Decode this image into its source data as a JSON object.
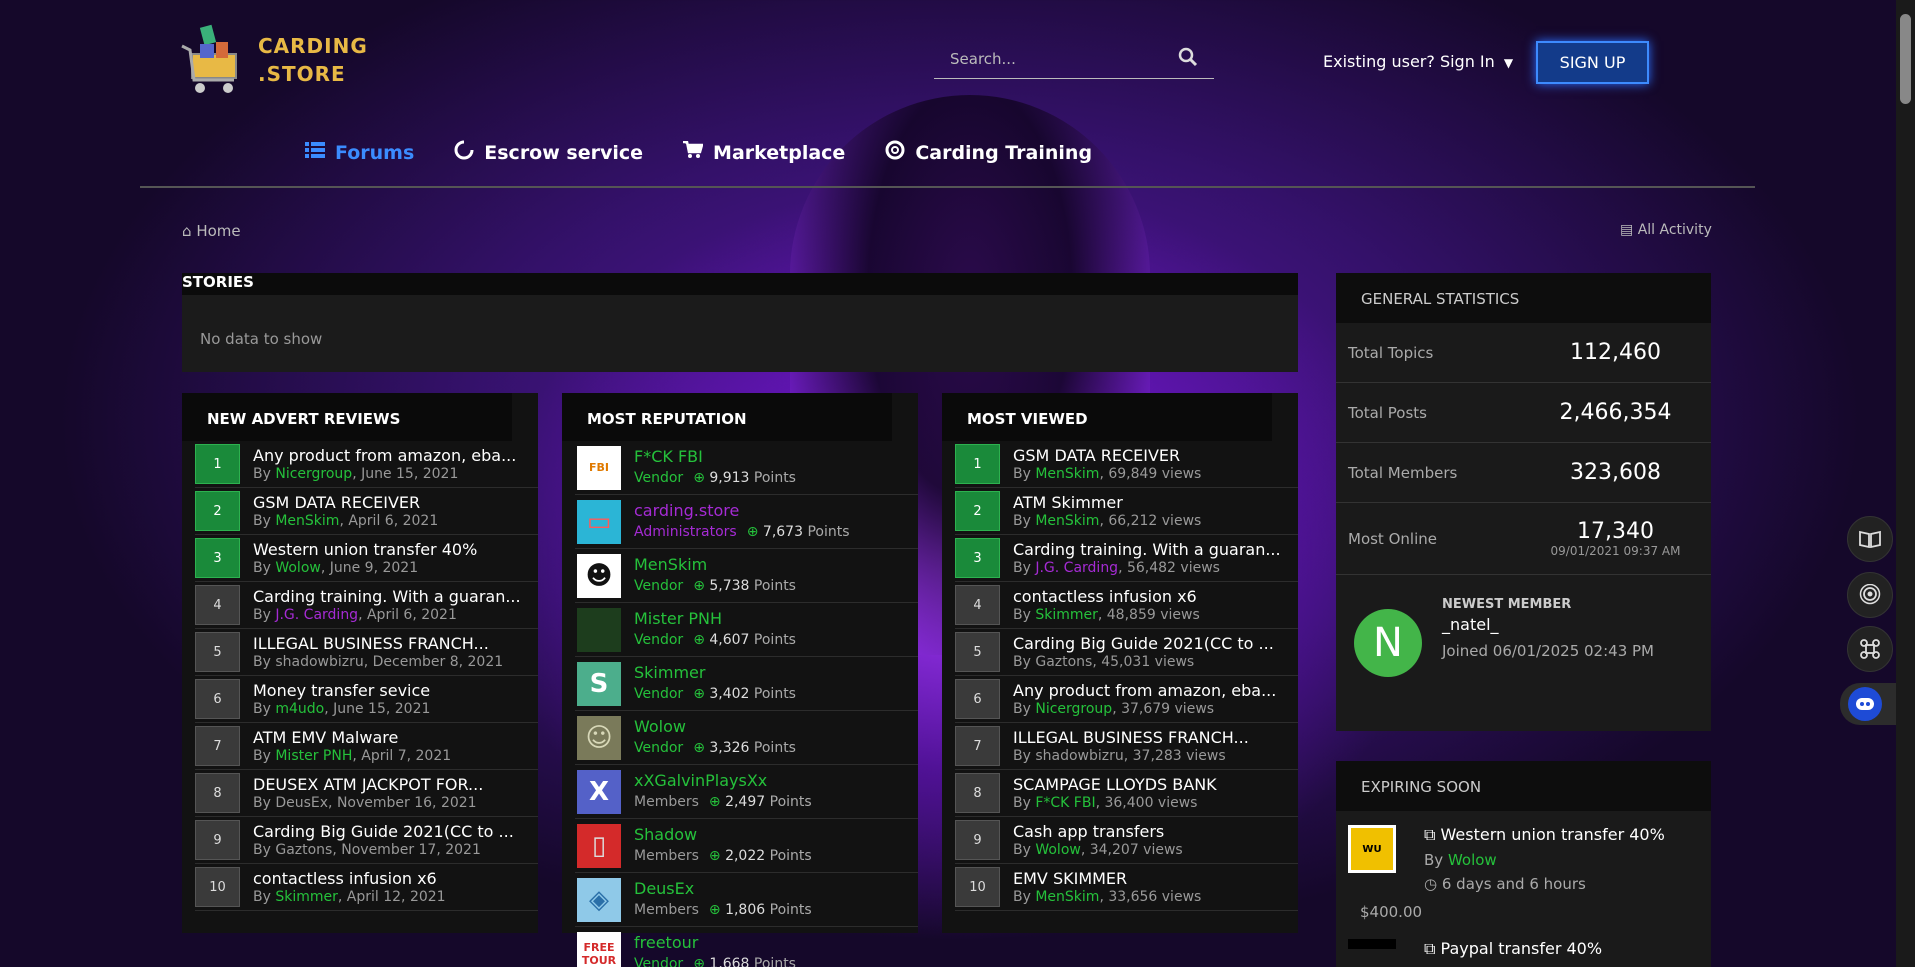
{
  "header": {
    "logo_line1": "CARDING",
    "logo_line2": ".STORE",
    "search_placeholder": "Search...",
    "signin_label": "Existing user? Sign In",
    "signup_label": "SIGN UP"
  },
  "nav": [
    {
      "label": "Forums",
      "icon": "list-icon",
      "active": true
    },
    {
      "label": "Escrow service",
      "icon": "circle-notch-icon"
    },
    {
      "label": "Marketplace",
      "icon": "cart-icon"
    },
    {
      "label": "Carding Training",
      "icon": "support-icon"
    }
  ],
  "breadcrumb": {
    "home": "Home",
    "all_activity": "All Activity"
  },
  "stories": {
    "title": "STORIES",
    "empty": "No data to show"
  },
  "new_advert_reviews": {
    "title": "NEW ADVERT REVIEWS",
    "items": [
      {
        "n": "1",
        "title": "Any product from amazon, eba...",
        "by": "Nicergroup",
        "date": ", June 15, 2021",
        "green": true,
        "role": "u"
      },
      {
        "n": "2",
        "title": "GSM DATA RECEIVER",
        "by": "MenSkim",
        "date": ", April 6, 2021",
        "green": true,
        "role": "u"
      },
      {
        "n": "3",
        "title": "Western union transfer 40%",
        "by": "Wolow",
        "date": ", June 9, 2021",
        "green": true,
        "role": "u"
      },
      {
        "n": "4",
        "title": "Carding training. With a guaran...",
        "by": "J.G. Carding",
        "date": ", April 6, 2021",
        "green": false,
        "role": "a"
      },
      {
        "n": "5",
        "title": "ILLEGAL BUSINESS FRANCH...",
        "by": "shadowbizru",
        "date": ", December 8, 2021",
        "green": false,
        "role": "n"
      },
      {
        "n": "6",
        "title": "Money transfer sevice",
        "by": "m4udo",
        "date": ", June 15, 2021",
        "green": false,
        "role": "u"
      },
      {
        "n": "7",
        "title": "ATM EMV Malware",
        "by": "Mister PNH",
        "date": ", April 7, 2021",
        "green": false,
        "role": "u"
      },
      {
        "n": "8",
        "title": "DEUSEX ATM JACKPOT FOR...",
        "by": "DeusEx",
        "date": ", November 16, 2021",
        "green": false,
        "role": "n"
      },
      {
        "n": "9",
        "title": "Carding Big Guide 2021(CC to ...",
        "by": "Gaztons",
        "date": ", November 17, 2021",
        "green": false,
        "role": "n"
      },
      {
        "n": "10",
        "title": "contactless infusion x6",
        "by": "Skimmer",
        "date": ", April 12, 2021",
        "green": false,
        "role": "u"
      }
    ]
  },
  "most_reputation": {
    "title": "MOST REPUTATION",
    "points_label": "Points",
    "items": [
      {
        "name": "F*CK FBI",
        "role": "Vendor",
        "points": "9,913",
        "type": "vendor",
        "avatar": "FBI",
        "bg": "#ffffff",
        "fg": "#e07a00"
      },
      {
        "name": "carding.store",
        "role": "Administrators",
        "points": "7,673",
        "type": "admin",
        "avatar": "▭",
        "bg": "#2bb5d6",
        "fg": "#ff5a5a"
      },
      {
        "name": "MenSkim",
        "role": "Vendor",
        "points": "5,738",
        "type": "vendor",
        "avatar": "☻",
        "bg": "#ffffff",
        "fg": "#111111"
      },
      {
        "name": "Mister PNH",
        "role": "Vendor",
        "points": "4,607",
        "type": "vendor",
        "avatar": "",
        "bg": "#1d3d1d",
        "fg": "#4a8a4a"
      },
      {
        "name": "Skimmer",
        "role": "Vendor",
        "points": "3,402",
        "type": "vendor",
        "avatar": "S",
        "bg": "#4cae8c",
        "fg": "#ffffff"
      },
      {
        "name": "Wolow",
        "role": "Vendor",
        "points": "3,326",
        "type": "vendor",
        "avatar": "☺",
        "bg": "#7a7a5a",
        "fg": "#d8d8b8"
      },
      {
        "name": "xXGalvinPlaysXx",
        "role": "Members",
        "points": "2,497",
        "type": "member",
        "avatar": "X",
        "bg": "#5461c8",
        "fg": "#ffffff"
      },
      {
        "name": "Shadow",
        "role": "Members",
        "points": "2,022",
        "type": "member",
        "avatar": "▯",
        "bg": "#d42a2a",
        "fg": "#dddddd"
      },
      {
        "name": "DeusEx",
        "role": "Members",
        "points": "1,806",
        "type": "member",
        "avatar": "◈",
        "bg": "#8fc9e8",
        "fg": "#2a6fa8"
      },
      {
        "name": "freetour",
        "role": "Vendor",
        "points": "1,668",
        "type": "vendor",
        "avatar": "FREE TOUR",
        "bg": "#ffffff",
        "fg": "#d42a2a"
      }
    ]
  },
  "most_viewed": {
    "title": "MOST VIEWED",
    "items": [
      {
        "n": "1",
        "title": "GSM DATA RECEIVER",
        "by": "MenSkim",
        "views": ", 69,849 views",
        "green": true,
        "role": "u"
      },
      {
        "n": "2",
        "title": "ATM Skimmer",
        "by": "MenSkim",
        "views": ", 66,212 views",
        "green": true,
        "role": "u"
      },
      {
        "n": "3",
        "title": "Carding training. With a guaran...",
        "by": "J.G. Carding",
        "views": ", 56,482 views",
        "green": true,
        "role": "a"
      },
      {
        "n": "4",
        "title": "contactless infusion x6",
        "by": "Skimmer",
        "views": ", 48,859 views",
        "green": false,
        "role": "u"
      },
      {
        "n": "5",
        "title": "Carding Big Guide 2021(CC to ...",
        "by": "Gaztons",
        "views": ", 45,031 views",
        "green": false,
        "role": "n"
      },
      {
        "n": "6",
        "title": "Any product from amazon, eba...",
        "by": "Nicergroup",
        "views": ", 37,679 views",
        "green": false,
        "role": "u"
      },
      {
        "n": "7",
        "title": "ILLEGAL BUSINESS FRANCH...",
        "by": "shadowbizru",
        "views": ", 37,283 views",
        "green": false,
        "role": "n"
      },
      {
        "n": "8",
        "title": "SCAMPAGE LLOYDS BANK",
        "by": "F*CK FBI",
        "views": ", 36,400 views",
        "green": false,
        "role": "u"
      },
      {
        "n": "9",
        "title": "Cash app transfers",
        "by": "Wolow",
        "views": ", 34,207 views",
        "green": false,
        "role": "u"
      },
      {
        "n": "10",
        "title": "EMV SKIMMER",
        "by": "MenSkim",
        "views": ", 33,656 views",
        "green": false,
        "role": "u"
      }
    ]
  },
  "general_statistics": {
    "title": "GENERAL STATISTICS",
    "total_topics_label": "Total Topics",
    "total_topics": "112,460",
    "total_posts_label": "Total Posts",
    "total_posts": "2,466,354",
    "total_members_label": "Total Members",
    "total_members": "323,608",
    "most_online_label": "Most Online",
    "most_online": "17,340",
    "most_online_date": "09/01/2021 09:37 AM",
    "newest_label": "NEWEST MEMBER",
    "newest_initial": "N",
    "newest_name": "_natel_",
    "newest_joined": "Joined 06/01/2025 02:43 PM"
  },
  "expiring": {
    "title": "EXPIRING SOON",
    "item_title": "Western union transfer 40%",
    "item_by_prefix": "By ",
    "item_by": "Wolow",
    "item_time": "6 days and 6 hours",
    "item_price": "$400.00",
    "item_image_text": "WU",
    "item2_title": "Paypal transfer 40%"
  },
  "by_prefix": "By ",
  "colors": {
    "accent": "#3b8cff",
    "vendor_green": "#25c13b",
    "admin_purple": "#a52bd4",
    "rank_green": "#1a8a3a"
  }
}
